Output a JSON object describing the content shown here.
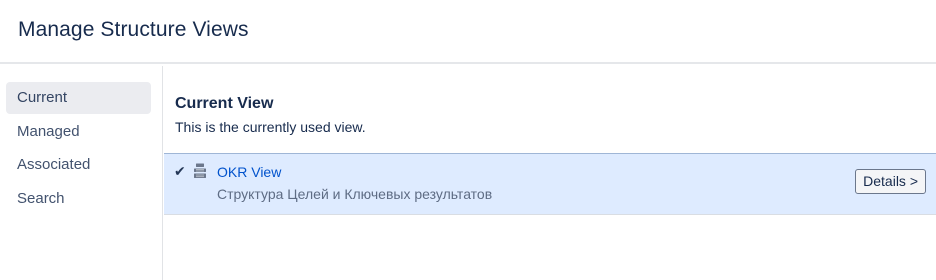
{
  "header": {
    "title": "Manage Structure Views"
  },
  "sidebar": {
    "items": [
      {
        "label": "Current",
        "active": true
      },
      {
        "label": "Managed",
        "active": false
      },
      {
        "label": "Associated",
        "active": false
      },
      {
        "label": "Search",
        "active": false
      }
    ]
  },
  "main": {
    "section_title": "Current View",
    "section_description": "This is the currently used view.",
    "current_view": {
      "name": "OKR View",
      "description": "Структура Целей и Ключевых результатов",
      "check_icon": "checkmark-icon",
      "view_icon": "structure-view-icon",
      "details_label": "Details >"
    }
  },
  "colors": {
    "row_highlight": "#deebff",
    "link": "#0052cc",
    "active_nav": "#ebecf0"
  }
}
